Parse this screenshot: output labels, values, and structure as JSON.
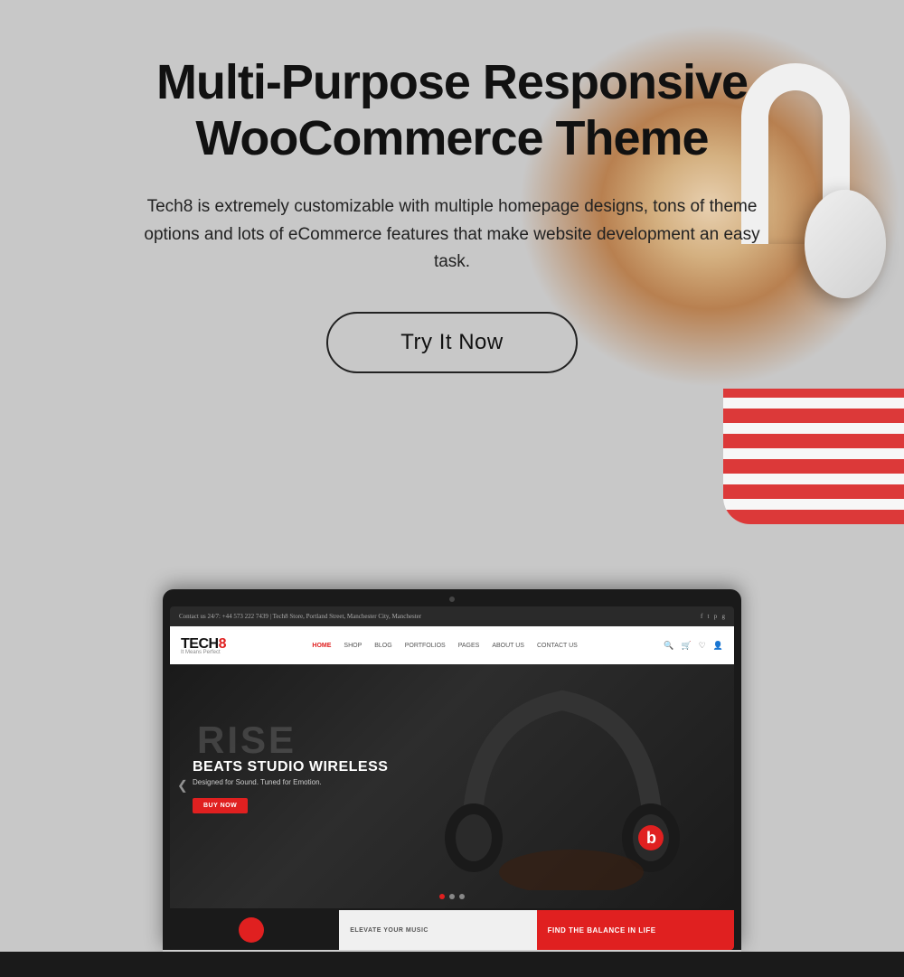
{
  "page": {
    "bg_color": "#c8c8c8"
  },
  "header": {
    "title_line1": "Multi-Purpose Responsive",
    "title_line2": "WooCommerce Theme"
  },
  "description": {
    "text": "Tech8 is extremely customizable with multiple homepage designs, tons of theme options and lots of eCommerce features that make website development an easy task."
  },
  "cta": {
    "button_label": "Try It Now"
  },
  "laptop_site": {
    "topbar_left": "Contact us 24/7: +44 573 222 7439  |  Tech8 Store, Portland Street, Manchester City, Manchester",
    "logo": "TECH8",
    "logo_subtitle": "It Means Perfect",
    "nav_links": [
      "HOME",
      "SHOP",
      "BLOG",
      "PORTFOLIOS",
      "PAGES",
      "ABOUT US",
      "CONTACT US"
    ],
    "hero_title": "BEATS STUDIO WIRELESS",
    "hero_subtitle": "Designed for Sound. Tuned for Emotion.",
    "hero_btn": "BUY NOW",
    "hero_bg_text": "RISE",
    "strip_left_text": "ELEVATE YOUR MUSIC",
    "strip_right_text": "FIND THE BALANCE IN LIFE"
  }
}
